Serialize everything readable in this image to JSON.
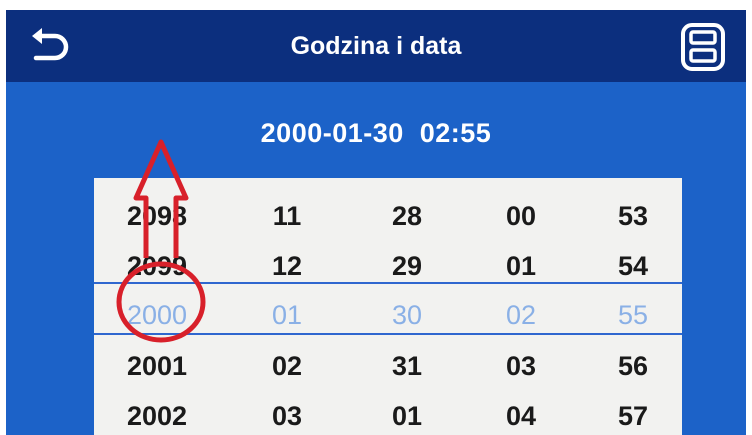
{
  "header": {
    "title": "Godzina i data",
    "back_icon": "back-arrow-icon",
    "save_icon": "save-disk-icon"
  },
  "current_datetime": "2000-01-30  02:55",
  "picker": {
    "rows": [
      {
        "year": "2098",
        "month": "11",
        "day": "28",
        "hour": "00",
        "minute": "53"
      },
      {
        "year": "2099",
        "month": "12",
        "day": "29",
        "hour": "01",
        "minute": "54"
      },
      {
        "year": "2000",
        "month": "01",
        "day": "30",
        "hour": "02",
        "minute": "55"
      },
      {
        "year": "2001",
        "month": "02",
        "day": "31",
        "hour": "03",
        "minute": "56"
      },
      {
        "year": "2002",
        "month": "03",
        "day": "01",
        "hour": "04",
        "minute": "57"
      }
    ],
    "selected_row_index": 2
  },
  "colors": {
    "header_bg": "#0c2f7e",
    "screen_bg": "#1c62c8",
    "picker_bg": "#f2f2f0",
    "selected_text": "#8ab0e6",
    "annotation": "#d8202a"
  }
}
